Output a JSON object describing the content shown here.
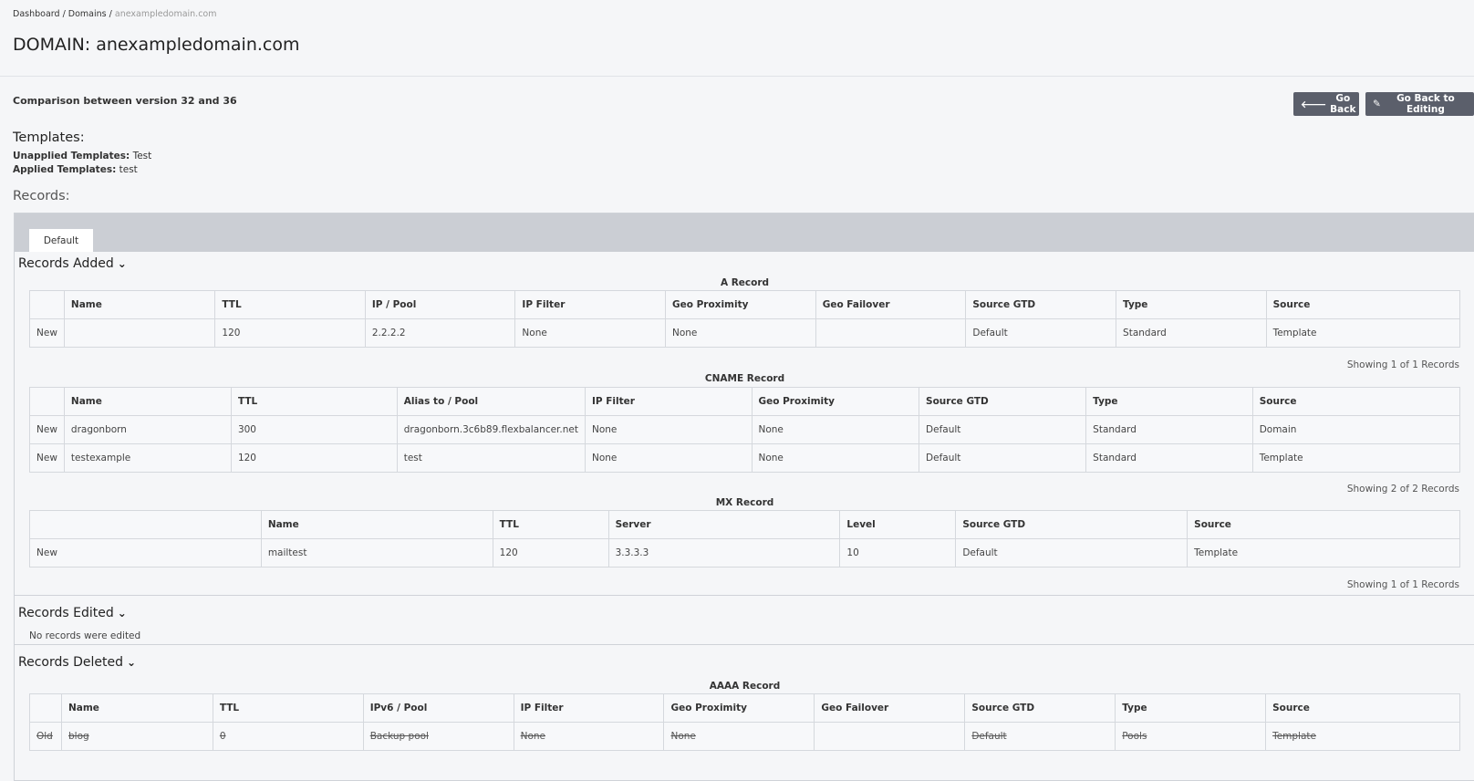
{
  "breadcrumb": {
    "dashboard": "Dashboard",
    "sep1": " / ",
    "domains": "Domains",
    "sep2": " / ",
    "current": "anexampledomain.com"
  },
  "page_title": "DOMAIN: anexampledomain.com",
  "comparison": "Comparison between version 32 and 36",
  "buttons": {
    "go_back": "Go Back",
    "go_back_editing": "Go Back to Editing"
  },
  "templates": {
    "heading": "Templates:",
    "unapplied_label": "Unapplied Templates:",
    "unapplied_value": "Test",
    "applied_label": "Applied Templates:",
    "applied_value": "test"
  },
  "records_heading": "Records:",
  "tabs": [
    {
      "label": "Default"
    }
  ],
  "sections": {
    "added": "Records Added",
    "edited": "Records Edited",
    "deleted": "Records Deleted"
  },
  "a_record": {
    "title": "A Record",
    "headers": [
      "",
      "Name",
      "TTL",
      "IP / Pool",
      "IP Filter",
      "Geo Proximity",
      "Geo Failover",
      "Source GTD",
      "Type",
      "Source"
    ],
    "rows": [
      [
        "New",
        "",
        "120",
        "2.2.2.2",
        "None",
        "None",
        "",
        "Default",
        "Standard",
        "Template"
      ]
    ],
    "showing": "Showing 1 of 1 Records"
  },
  "cname_record": {
    "title": "CNAME Record",
    "headers": [
      "",
      "Name",
      "TTL",
      "Alias to / Pool",
      "IP Filter",
      "Geo Proximity",
      "Source GTD",
      "Type",
      "Source"
    ],
    "rows": [
      [
        "New",
        "dragonborn",
        "300",
        "dragonborn.3c6b89.flexbalancer.net",
        "None",
        "None",
        "Default",
        "Standard",
        "Domain"
      ],
      [
        "New",
        "testexample",
        "120",
        "test",
        "None",
        "None",
        "Default",
        "Standard",
        "Template"
      ]
    ],
    "showing": "Showing 2 of 2 Records"
  },
  "mx_record": {
    "title": "MX Record",
    "headers": [
      "",
      "Name",
      "TTL",
      "Server",
      "Level",
      "Source GTD",
      "Source"
    ],
    "rows": [
      [
        "New",
        "mailtest",
        "120",
        "3.3.3.3",
        "10",
        "Default",
        "Template"
      ]
    ],
    "showing": "Showing 1 of 1 Records"
  },
  "edited_message": "No records were edited",
  "aaaa_record": {
    "title": "AAAA Record",
    "headers": [
      "",
      "Name",
      "TTL",
      "IPv6 / Pool",
      "IP Filter",
      "Geo Proximity",
      "Geo Failover",
      "Source GTD",
      "Type",
      "Source"
    ],
    "rows": [
      [
        "Old",
        "blog",
        "0",
        "Backup pool",
        "None",
        "None",
        "",
        "Default",
        "Pools",
        "Template"
      ]
    ]
  },
  "icons": {
    "back": "arrow-left-icon",
    "edit": "pencil-icon",
    "chevron": "chevron-down-icon"
  }
}
